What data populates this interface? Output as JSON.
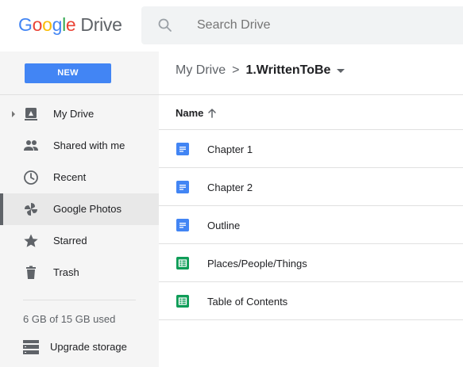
{
  "header": {
    "logo": {
      "g1": "G",
      "g2": "o",
      "g3": "o",
      "g4": "g",
      "g5": "l",
      "g6": "e",
      "product": "Drive"
    },
    "search_placeholder": "Search Drive"
  },
  "toolbar": {
    "new_label": "NEW",
    "breadcrumb": {
      "root": "My Drive",
      "separator": ">",
      "current": "1.WrittenToBe"
    }
  },
  "sidebar": {
    "items": [
      {
        "label": "My Drive",
        "icon": "drive-icon"
      },
      {
        "label": "Shared with me",
        "icon": "people-icon"
      },
      {
        "label": "Recent",
        "icon": "clock-icon"
      },
      {
        "label": "Google Photos",
        "icon": "pinwheel-icon",
        "active": true
      },
      {
        "label": "Starred",
        "icon": "star-icon"
      },
      {
        "label": "Trash",
        "icon": "trash-icon"
      }
    ],
    "storage_text": "6 GB of 15 GB used",
    "upgrade_label": "Upgrade storage"
  },
  "file_list": {
    "column_name": "Name",
    "sort_direction": "ascending",
    "files": [
      {
        "name": "Chapter 1",
        "type": "doc"
      },
      {
        "name": "Chapter 2",
        "type": "doc"
      },
      {
        "name": "Outline",
        "type": "doc"
      },
      {
        "name": "Places/People/Things",
        "type": "sheet"
      },
      {
        "name": "Table of Contents",
        "type": "sheet"
      }
    ]
  },
  "colors": {
    "accent_blue": "#4285f4",
    "sheet_green": "#0f9d58",
    "sidebar_bg": "#f5f5f5"
  }
}
